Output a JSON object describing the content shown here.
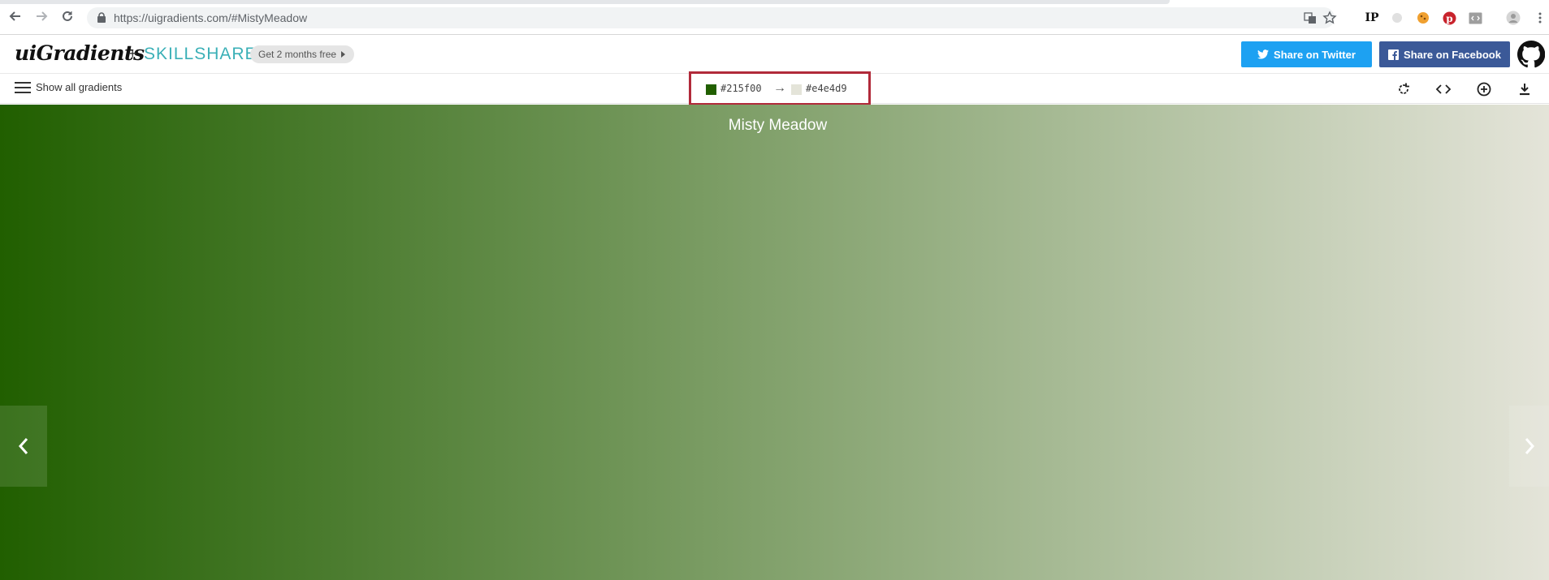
{
  "browser": {
    "url": "https://uigradients.com/#MistyMeadow",
    "nav_icons": [
      "back-arrow-icon",
      "forward-arrow-icon",
      "reload-icon"
    ],
    "extensions": [
      "translate-icon",
      "bookmark-star-icon",
      "ip-extension-icon",
      "circle-extension-icon",
      "cookie-extension-icon",
      "pinterest-icon",
      "code-extension-icon",
      "profile-avatar-icon",
      "kebab-menu-icon"
    ],
    "ip_label": "IP"
  },
  "header": {
    "logo": "uiGradients",
    "plus": "+",
    "partner": "SKILLSHARE",
    "promo": "Get 2 months free",
    "twitter_label": "Share on Twitter",
    "facebook_label": "Share on Facebook",
    "colors": {
      "twitter": "#1da1f2",
      "facebook": "#3b5998",
      "skillshare": "#3bb0b7"
    }
  },
  "toolbar": {
    "menu_label": "Show all gradients",
    "color_from": "#215f00",
    "color_to": "#e4e4d9",
    "arrow": "→",
    "highlight_color": "#b12a3a",
    "tools": [
      "rotate-icon",
      "code-icon",
      "add-icon",
      "download-icon"
    ]
  },
  "gradient": {
    "name": "Misty Meadow",
    "start": "#215f00",
    "end": "#e4e4d9"
  }
}
